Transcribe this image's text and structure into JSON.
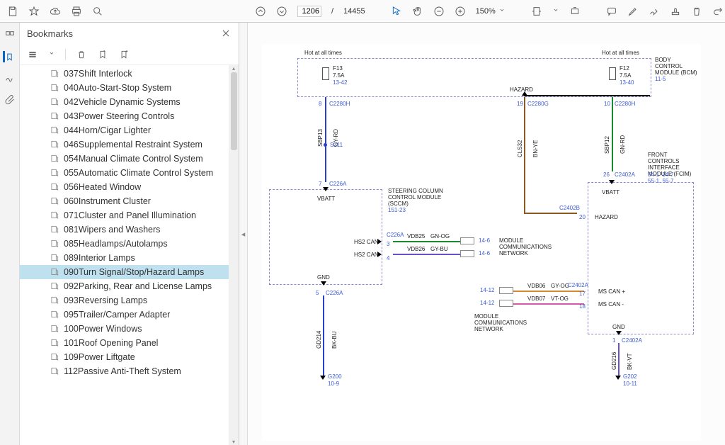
{
  "toolbar": {
    "current_page": "1206",
    "total_pages": "14455",
    "zoom": "150%"
  },
  "panel": {
    "title": "Bookmarks"
  },
  "bookmarks": [
    {
      "label": "037Shift Interlock",
      "selected": false
    },
    {
      "label": "040Auto-Start-Stop System",
      "selected": false
    },
    {
      "label": "042Vehicle Dynamic Systems",
      "selected": false
    },
    {
      "label": "043Power Steering Controls",
      "selected": false
    },
    {
      "label": "044Horn/Cigar Lighter",
      "selected": false
    },
    {
      "label": "046Supplemental Restraint System",
      "selected": false
    },
    {
      "label": "054Manual Climate Control System",
      "selected": false
    },
    {
      "label": "055Automatic Climate Control System",
      "selected": false
    },
    {
      "label": "056Heated Window",
      "selected": false
    },
    {
      "label": "060Instrument Cluster",
      "selected": false
    },
    {
      "label": "071Cluster and Panel Illumination",
      "selected": false
    },
    {
      "label": "081Wipers and Washers",
      "selected": false
    },
    {
      "label": "085Headlamps/Autolamps",
      "selected": false
    },
    {
      "label": "089Interior Lamps",
      "selected": false
    },
    {
      "label": "090Turn Signal/Stop/Hazard Lamps",
      "selected": true
    },
    {
      "label": "092Parking, Rear and License Lamps",
      "selected": false
    },
    {
      "label": "093Reversing Lamps",
      "selected": false
    },
    {
      "label": "095Trailer/Camper Adapter",
      "selected": false
    },
    {
      "label": "100Power Windows",
      "selected": false
    },
    {
      "label": "101Roof Opening Panel",
      "selected": false
    },
    {
      "label": "109Power Liftgate",
      "selected": false
    },
    {
      "label": "112Passive Anti-Theft System",
      "selected": false
    }
  ],
  "diagram": {
    "top_left_note": "Hot at all times",
    "top_right_note": "Hot at all times",
    "bcm": {
      "title": "BODY CONTROL MODULE (BCM)",
      "ref": "11-5"
    },
    "fuse_left": {
      "name": "F13",
      "rating": "7.5A",
      "ref": "13-42"
    },
    "fuse_right": {
      "name": "F12",
      "rating": "7.5A",
      "ref": "13-40"
    },
    "hazard": "HAZARD",
    "pin8": "8",
    "c2280h_l": "C2280H",
    "pin19": "19",
    "c2280g": "C2280G",
    "pin10": "10",
    "c2280h_r": "C2280H",
    "sbp13": "SBP13",
    "gyrd_l": "GY-RD",
    "s211": "S211",
    "cls32": "CLS32",
    "bnye": "BN-YE",
    "sbp12": "SBP12",
    "gnrd": "GN-RD",
    "pin7": "7",
    "c226a_top": "C226A",
    "vbatt_l": "VBATT",
    "sccm": {
      "title": "STEERING COLUMN CONTROL MODULE (SCCM)",
      "ref": "151-23"
    },
    "fcim": {
      "title": "FRONT CONTROLS INTERFACE MODULE (FCIM)",
      "refs": "54-1  54-7\n55-1  55-7"
    },
    "pin26": "26",
    "c2402a_top": "C2402A",
    "c2402b": "C2402B",
    "pin20": "20",
    "vbatt_r": "VBATT",
    "hazard_r": "HAZARD",
    "hs2can1": "HS2 CAN",
    "hs2can2": "HS2 CAN",
    "c226a_mid": "C226A",
    "pin3": "3",
    "pin4": "4",
    "vdb25": "VDB25",
    "gnog": "GN-OG",
    "vdb26": "VDB26",
    "gybu": "GY-BU",
    "ref146a": "14-6",
    "ref146b": "14-6",
    "mcn1": "MODULE COMMUNICATIONS NETWORK",
    "gnd_l": "GND",
    "pin5": "5",
    "c226a_bot": "C226A",
    "gd214": "GD214",
    "bkbu": "BK-BU",
    "g200": "G200",
    "g200ref": "10-9",
    "ref1412a": "14-12",
    "ref1412b": "14-12",
    "vdb06": "VDB06",
    "gyog": "GY-OG",
    "vdb07": "VDB07",
    "vtog": "VT-OG",
    "c2402a_mid": "C2402A",
    "pin17": "17",
    "pin18": "18",
    "mscanp": "MS CAN +",
    "mscanm": "MS CAN -",
    "mcn2": "MODULE COMMUNICATIONS NETWORK",
    "gnd_r": "GND",
    "pin1": "1",
    "c2402a_bot": "C2402A",
    "gd216": "GD216",
    "bkvt": "BK-VT",
    "g202": "G202",
    "g202ref": "10-11"
  }
}
